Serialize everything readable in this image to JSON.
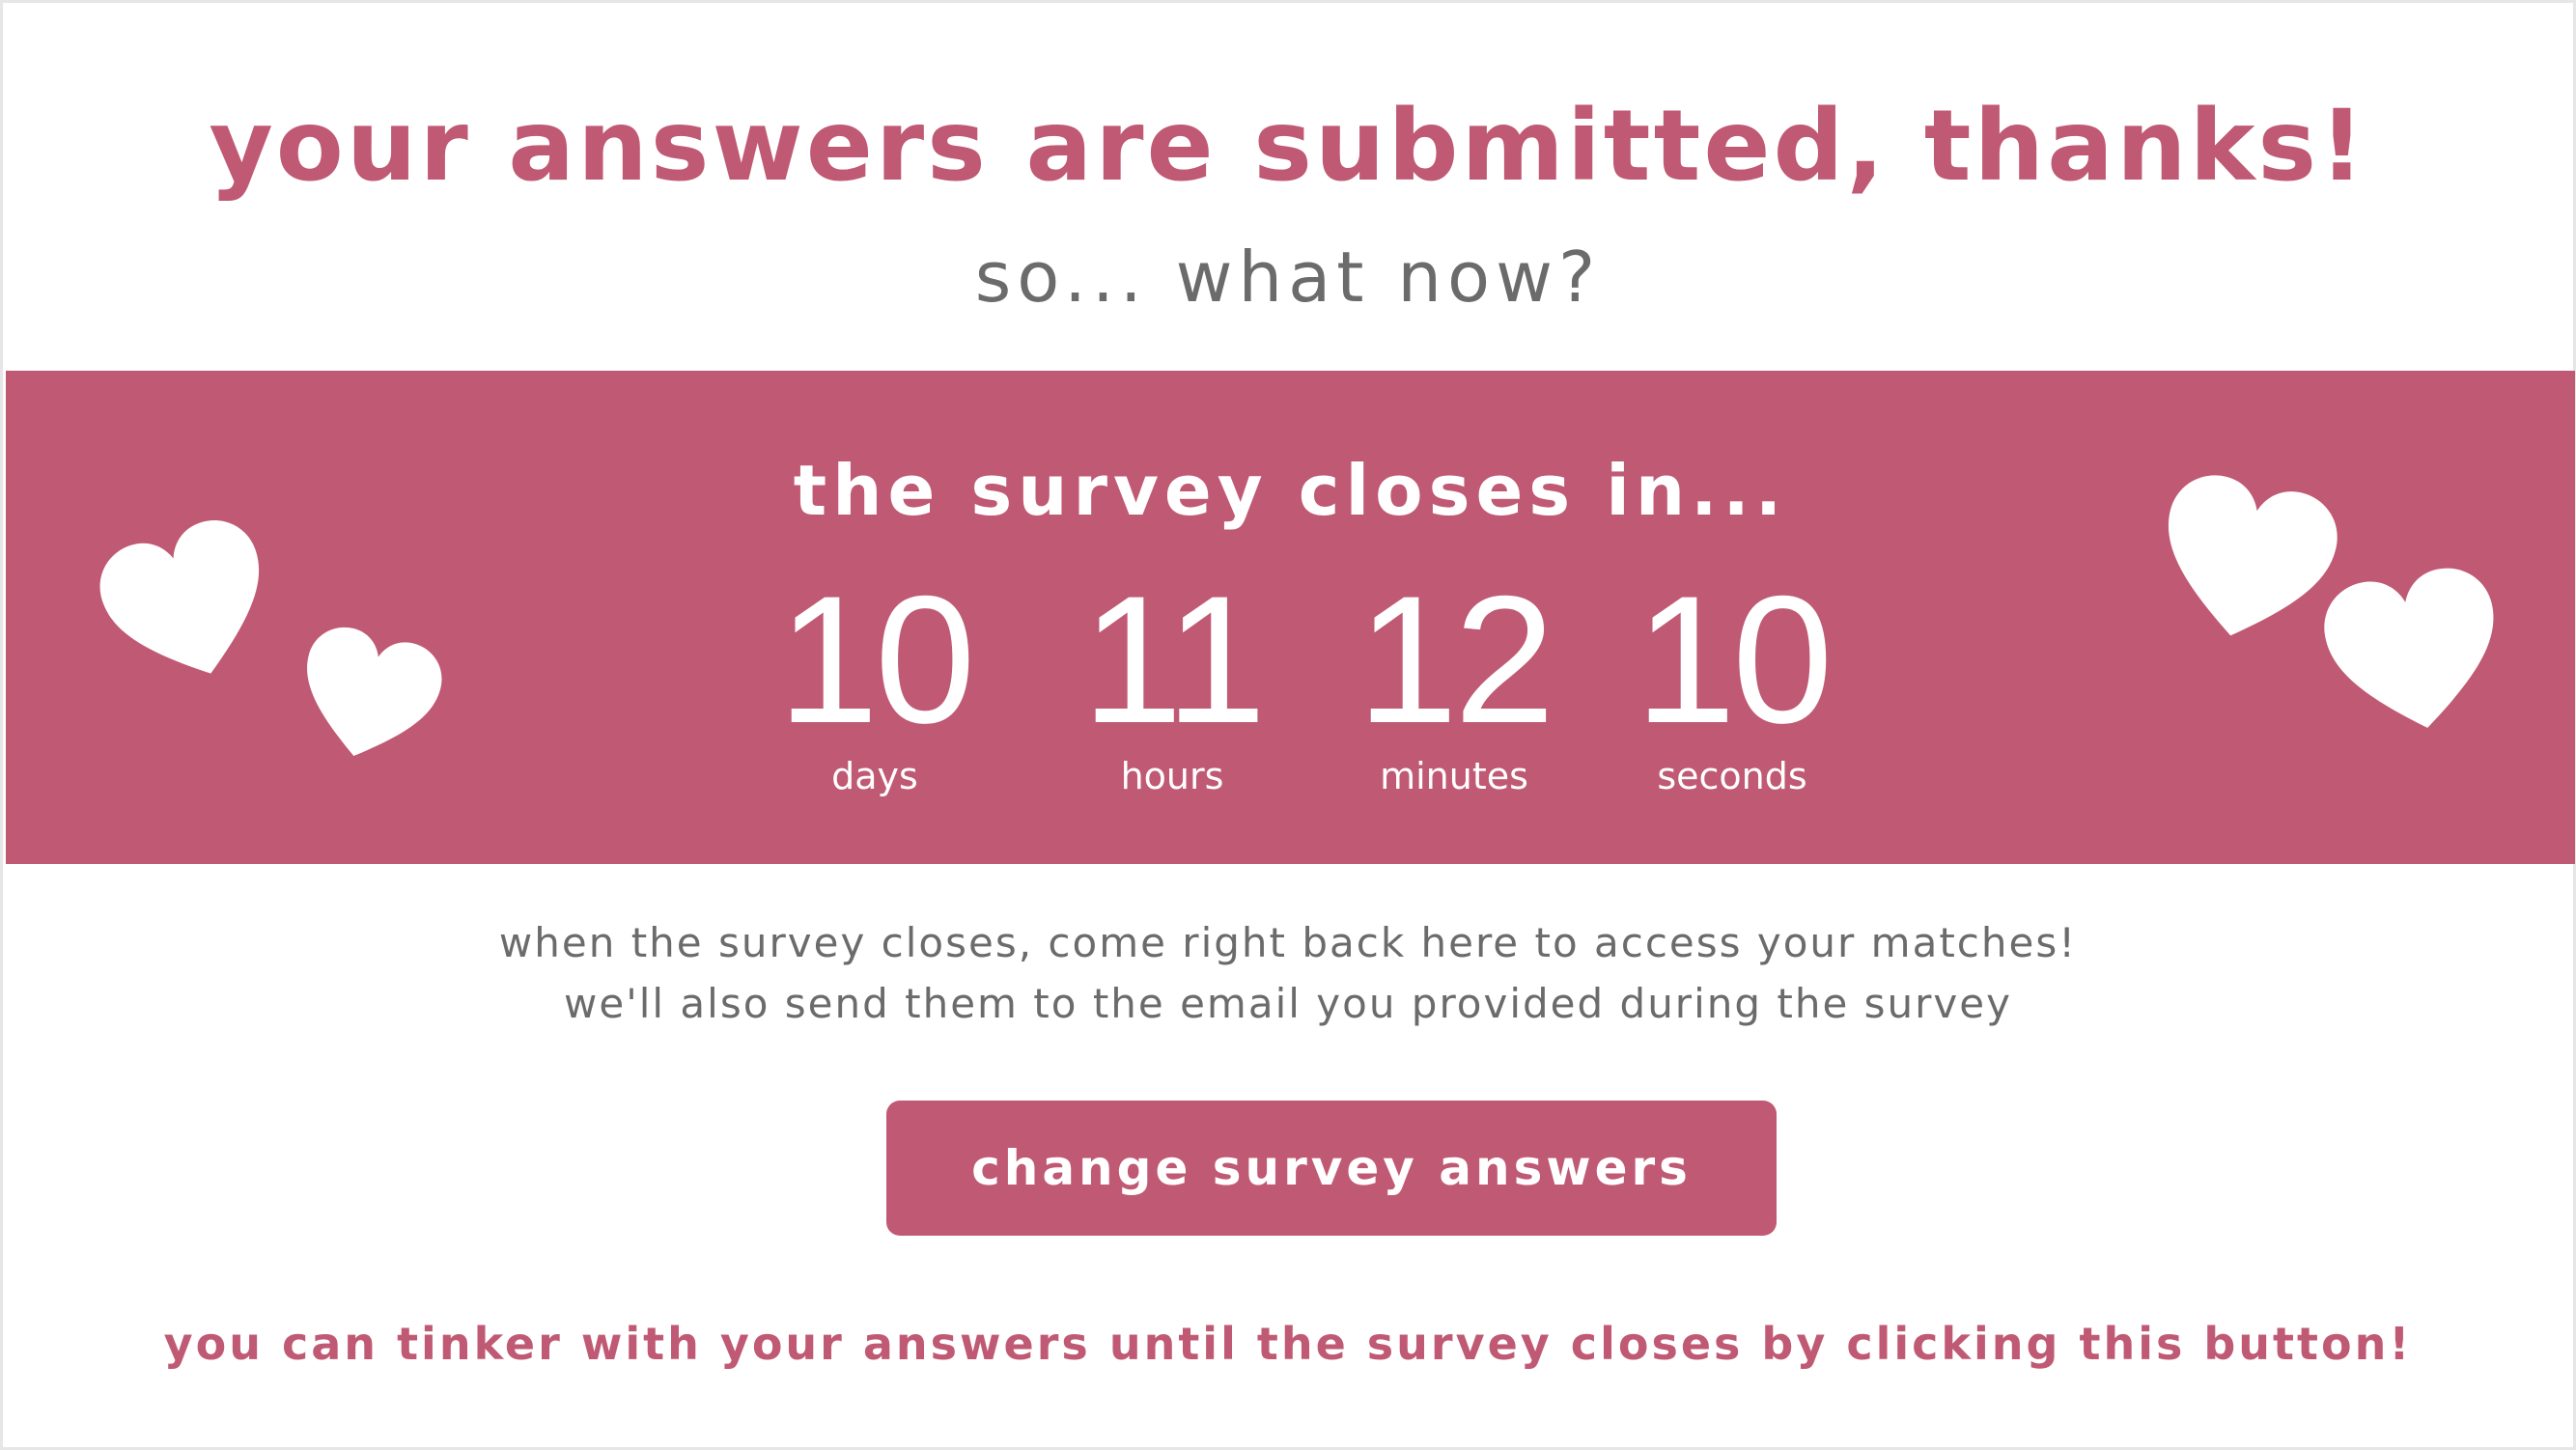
{
  "page": {
    "headline": "your answers are submitted, thanks!",
    "subheadline": "so... what now?"
  },
  "countdown": {
    "title": "the survey closes in...",
    "units": [
      {
        "value": "10",
        "label": "days"
      },
      {
        "value": "11",
        "label": "hours"
      },
      {
        "value": "12",
        "label": "minutes"
      },
      {
        "value": "10",
        "label": "seconds"
      }
    ]
  },
  "info": {
    "line1": "when the survey closes, come right back here to access your matches!",
    "line2": "we'll also send them to the email you provided during the survey"
  },
  "actions": {
    "change_answers_label": "change survey answers",
    "hint": "you can tinker with your answers until the survey closes by clicking this button!"
  },
  "colors": {
    "accent": "#c05a74",
    "text_gray": "#6b6b6b",
    "background": "#ffffff"
  },
  "icons": [
    "heart-icon"
  ]
}
